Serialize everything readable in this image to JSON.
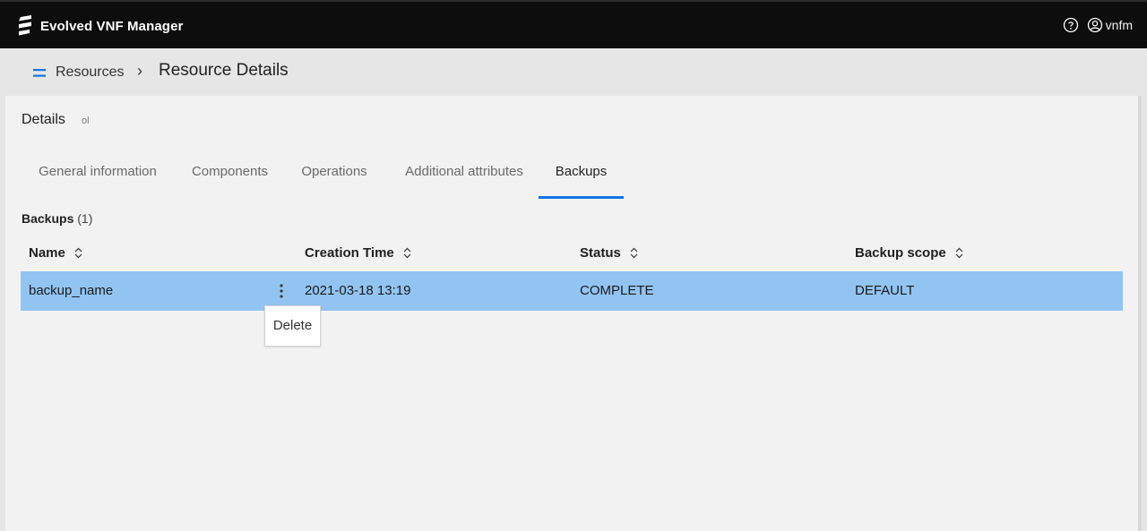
{
  "app": {
    "title": "Evolved VNF Manager",
    "logo": "ericsson-logo-icon"
  },
  "topbar": {
    "help_icon": "help-circle-icon",
    "user_icon": "user-circle-icon",
    "username": "vnfm"
  },
  "breadcrumb": {
    "menu_icon": "menu-icon",
    "root": "Resources",
    "separator": "›",
    "current": "Resource Details"
  },
  "details": {
    "title": "Details",
    "subtitle": "ol"
  },
  "tabs": [
    {
      "label": "General information",
      "active": false
    },
    {
      "label": "Components",
      "active": false
    },
    {
      "label": "Operations",
      "active": false
    },
    {
      "label": "Additional attributes",
      "active": false
    },
    {
      "label": "Backups",
      "active": true
    }
  ],
  "backups": {
    "title": "Backups",
    "count": "(1)",
    "columns": [
      "Name",
      "Creation Time",
      "Status",
      "Backup scope"
    ],
    "rows": [
      {
        "name": "backup_name",
        "creation_time": "2021-03-18 13:19",
        "status": "COMPLETE",
        "scope": "DEFAULT",
        "selected": true
      }
    ]
  },
  "context_menu": {
    "items": [
      "Delete"
    ]
  },
  "colors": {
    "topbar": "#0d0d0d",
    "accent": "#1174e6",
    "row_selected": "#92c4f2"
  }
}
